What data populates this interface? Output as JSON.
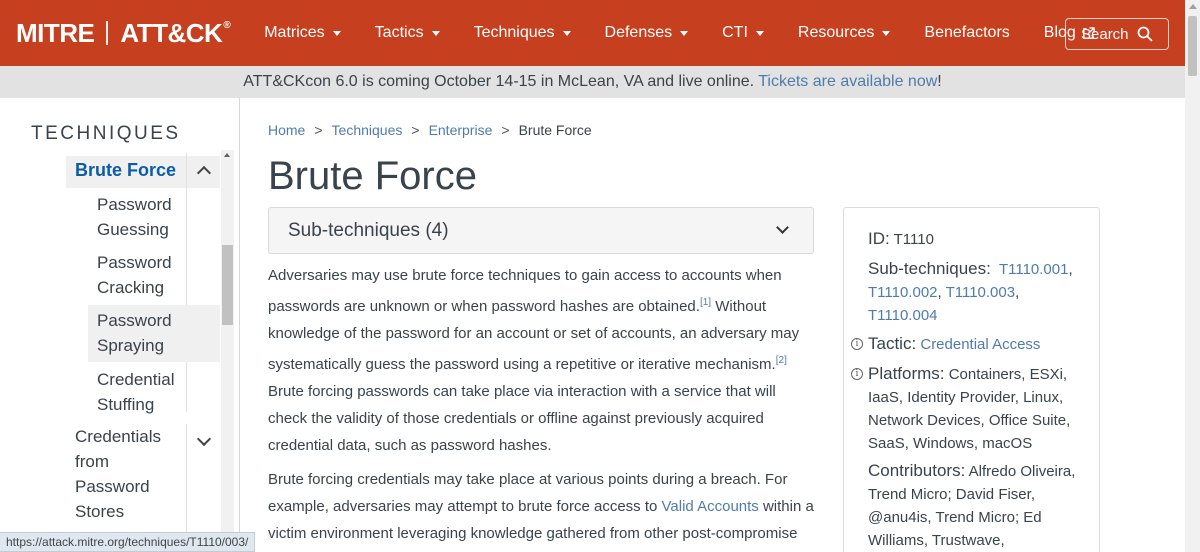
{
  "navbar": {
    "logo_left": "MITRE",
    "logo_right": "ATT&CK",
    "logo_reg": "®",
    "items": [
      {
        "label": "Matrices",
        "dropdown": true
      },
      {
        "label": "Tactics",
        "dropdown": true
      },
      {
        "label": "Techniques",
        "dropdown": true
      },
      {
        "label": "Defenses",
        "dropdown": true
      },
      {
        "label": "CTI",
        "dropdown": true
      },
      {
        "label": "Resources",
        "dropdown": true
      },
      {
        "label": "Benefactors",
        "dropdown": false
      },
      {
        "label": "Blog",
        "dropdown": false,
        "external": true
      }
    ],
    "search_label": "Search"
  },
  "banner": {
    "text": "ATT&CKcon 6.0 is coming October 14-15 in McLean, VA and live online.",
    "link": "Tickets are available now",
    "suffix": "!"
  },
  "sidebar": {
    "title": "TECHNIQUES",
    "active": "Brute Force",
    "subitems": [
      {
        "label_1": "Password",
        "label_2": "Guessing"
      },
      {
        "label_1": "Password",
        "label_2": "Cracking"
      },
      {
        "label_1": "Password",
        "label_2": "Spraying"
      },
      {
        "label_1": "Credential",
        "label_2": "Stuffing"
      }
    ],
    "next_item": {
      "line_1": "Credentials",
      "line_2": "from",
      "line_3": "Password",
      "line_4": "Stores"
    }
  },
  "status_url": "https://attack.mitre.org/techniques/T1110/003/",
  "breadcrumb": [
    "Home",
    "Techniques",
    "Enterprise",
    "Brute Force"
  ],
  "page": {
    "title": "Brute Force",
    "subtech_label": "Sub-techniques (4)",
    "p1_a": "Adversaries may use brute force techniques to gain access to accounts when passwords are unknown or when password hashes are obtained.",
    "p1_ref1": "[1]",
    "p1_b": " Without knowledge of the password for an account or set of accounts, an adversary may systematically guess the password using a repetitive or iterative mechanism.",
    "p1_ref2": "[2]",
    "p1_c": " Brute forcing passwords can take place via interaction with a service that will check the validity of those credentials or offline against previously acquired credential data, such as password hashes.",
    "p2_a": "Brute forcing credentials may take place at various points during a breach. For example, adversaries may attempt to brute force access to ",
    "p2_link": "Valid Accounts",
    "p2_b": " within a victim environment leveraging knowledge gathered from other post-compromise"
  },
  "card": {
    "id_key": "ID:",
    "id_val": "T1110",
    "sub_key": "Sub-techniques:",
    "subs": [
      "T1110.001",
      "T1110.002",
      "T1110.003",
      "T1110.004"
    ],
    "tactic_key": "Tactic:",
    "tactic_val": "Credential Access",
    "platforms_key": "Platforms:",
    "platforms_val": "Containers, ESXi, IaaS, Identity Provider, Linux, Network Devices, Office Suite, SaaS, Windows, macOS",
    "contrib_key": "Contributors:",
    "contrib_val": "Alfredo Oliveira, Trend Micro; David Fiser, @anu4is, Trend Micro; Ed Williams, Trustwave,"
  },
  "colors": {
    "nav_bg": "#c63f1f",
    "banner_bg": "#e2e2e2",
    "link": "#4f7cac",
    "active_side": "#0b5cab"
  }
}
